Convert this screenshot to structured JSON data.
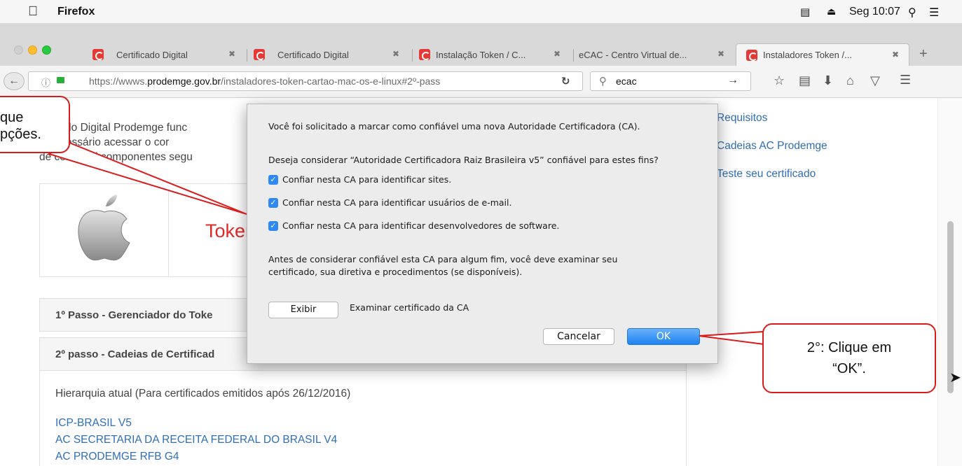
{
  "menubar": {
    "app_name": "Firefox",
    "clock": "Seg 10:07"
  },
  "tabs": [
    {
      "label": "Certificado Digital"
    },
    {
      "label": "Certificado Digital"
    },
    {
      "label": "Instalação Token / C..."
    },
    {
      "label": "eCAC - Centro Virtual de..."
    },
    {
      "label": "Instaladores Token /..."
    }
  ],
  "navbar": {
    "url_prefix": "https://wwws.",
    "url_domain": "prodemge.gov.br",
    "url_path": "/instaladores-token-cartao-mac-os-e-linux#2º-pass",
    "search_value": "ecac"
  },
  "page": {
    "intro_lines": [
      "rtificado Digital Prodemge func",
      "é necessário acessar o cor",
      "de certificad     componentes segu"
    ],
    "token_title": "Token S",
    "step1": "1º Passo - Gerenciador do Toke",
    "step2": "2º passo - Cadeias de Certificad",
    "hierarchy": "Hierarquia atual (Para certificados emitidos após 26/12/2016)",
    "links": [
      "ICP-BRASIL V5",
      "AC SECRETARIA DA RECEITA FEDERAL DO BRASIL V4",
      "AC PRODEMGE RFB G4"
    ],
    "sidebar_links": [
      "Requisitos",
      "Cadeias AC Prodemge",
      "Teste seu certificado"
    ]
  },
  "dialog": {
    "message": "Você foi solicitado a marcar como confiável uma nova Autoridade Certificadora (CA).",
    "question": "Deseja considerar “Autoridade Certificadora Raiz Brasileira v5” confiável para estes fins?",
    "options": [
      {
        "label": "Confiar nesta CA para identificar sites.",
        "checked": true
      },
      {
        "label": "Confiar nesta CA para identificar usuários de e-mail.",
        "checked": true
      },
      {
        "label": "Confiar nesta CA para identificar desenvolvedores de software.",
        "checked": true
      }
    ],
    "note_line1": "Antes de considerar confiável esta CA para algum fim, você deve examinar seu",
    "note_line2": "certificado, sua diretiva e procedimentos (se disponíveis).",
    "view_button": "Exibir",
    "view_label": "Examinar certificado da CA",
    "cancel_button": "Cancelar",
    "ok_button": "OK"
  },
  "callouts": {
    "first_line1": "que",
    "first_line2": "pções.",
    "second_line1": "2°: Clique em",
    "second_line2": "“OK”."
  },
  "colors": {
    "accent": "#2f89f5",
    "callout_border": "#d81b1b",
    "link": "#2e6fb5",
    "token_title": "#e02a2a"
  }
}
